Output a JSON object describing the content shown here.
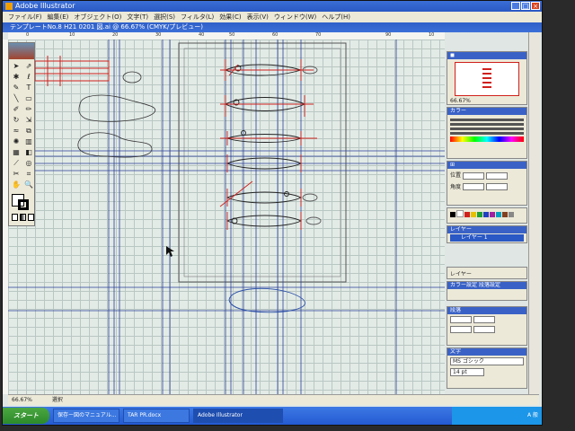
{
  "app": {
    "title": "Adobe Illustrator"
  },
  "menu": [
    "ファイル(F)",
    "編集(E)",
    "オブジェクト(O)",
    "文字(T)",
    "選択(S)",
    "フィルタ(L)",
    "効果(C)",
    "表示(V)",
    "ウィンドウ(W)",
    "ヘルプ(H)"
  ],
  "document": {
    "title": "テンプレートNo.8 H21 0201 図.ai @ 66.67% (CMYK/プレビュー)"
  },
  "ruler": {
    "ticks": [
      "0",
      "10",
      "20",
      "30",
      "40",
      "50",
      "60",
      "70",
      "90",
      "10"
    ]
  },
  "panels": {
    "navigator": {
      "zoom": "66.67%"
    },
    "color": {
      "tab": "カラー"
    },
    "transform": {
      "rows": [
        "位置",
        "角度"
      ]
    },
    "layers": {
      "tab": "レイヤー",
      "layer_name": "レイヤー 1"
    },
    "layers_footer": {
      "tab": "レイヤー"
    },
    "character": {
      "tabs": [
        "カラー設定",
        "段落設定"
      ]
    },
    "paragraph": {
      "tab": "段落"
    },
    "font": {
      "tab": "文字",
      "font_name": "MS ゴシック",
      "size": "14 pt"
    }
  },
  "status": {
    "zoom": "66.67%",
    "tool": "選択"
  },
  "taskbar": {
    "start": "スタート",
    "tasks": [
      "保存ー図のマニュアル...",
      "TAR PR.docx",
      "Adobe Illustrator"
    ],
    "tray": "A 般"
  },
  "colors": {
    "accent_red": "#d0201c",
    "guide_blue": "#2a3f9a",
    "titlebar": "#2a58c4"
  }
}
